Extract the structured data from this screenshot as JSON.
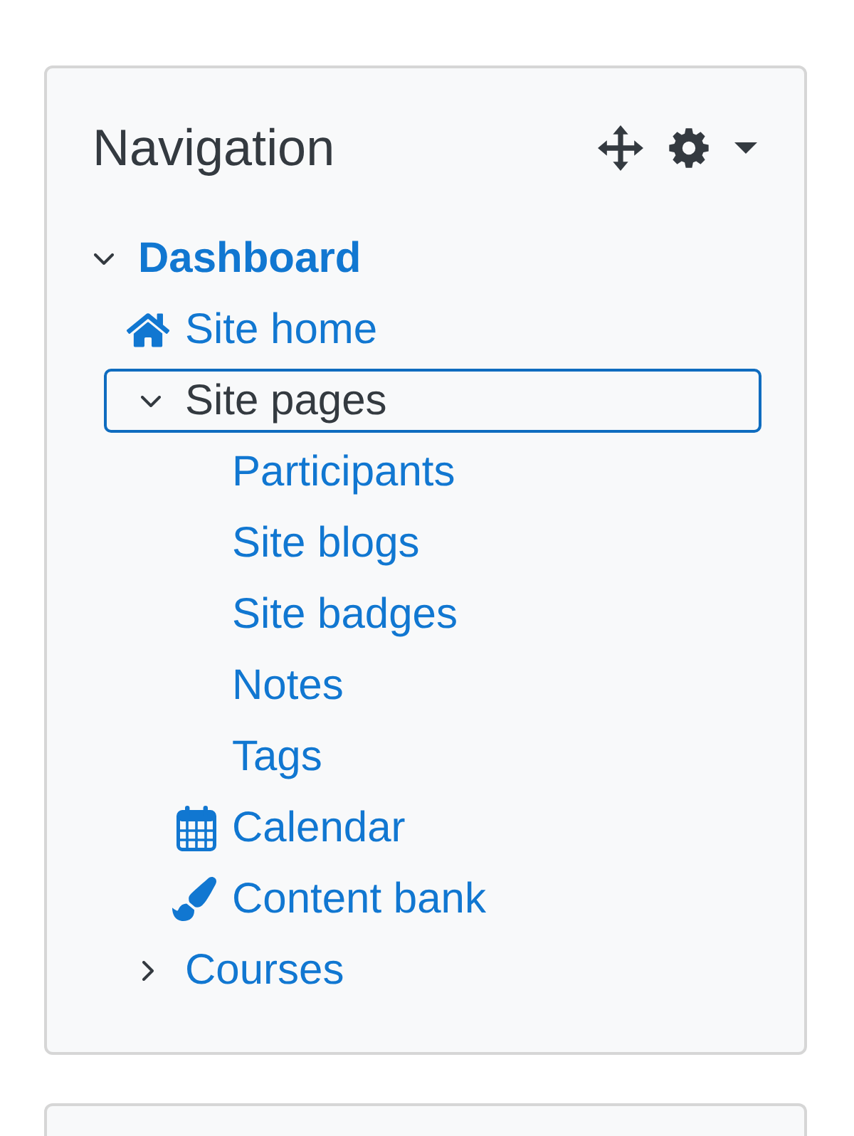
{
  "block": {
    "title": "Navigation"
  },
  "tree": [
    {
      "label": "Dashboard",
      "kind": "branch",
      "expanded": true,
      "link": true,
      "current": true,
      "selected": false,
      "children": [
        {
          "label": "Site home",
          "kind": "home",
          "link": true,
          "current": false,
          "selected": false
        },
        {
          "label": "Site pages",
          "kind": "branch",
          "expanded": true,
          "link": false,
          "current": false,
          "selected": true,
          "children": [
            {
              "label": "Participants",
              "kind": "page",
              "link": true,
              "current": false,
              "selected": false
            },
            {
              "label": "Site blogs",
              "kind": "page",
              "link": true,
              "current": false,
              "selected": false
            },
            {
              "label": "Site badges",
              "kind": "page",
              "link": true,
              "current": false,
              "selected": false
            },
            {
              "label": "Notes",
              "kind": "page",
              "link": true,
              "current": false,
              "selected": false
            },
            {
              "label": "Tags",
              "kind": "page",
              "link": true,
              "current": false,
              "selected": false
            },
            {
              "label": "Calendar",
              "kind": "calendar",
              "link": true,
              "current": false,
              "selected": false
            },
            {
              "label": "Content bank",
              "kind": "contentbank",
              "link": true,
              "current": false,
              "selected": false
            }
          ]
        },
        {
          "label": "Courses",
          "kind": "branch",
          "expanded": false,
          "link": true,
          "current": false,
          "selected": false
        }
      ]
    }
  ]
}
